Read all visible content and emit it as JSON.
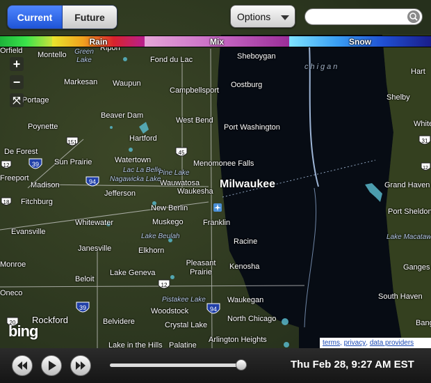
{
  "toolbar": {
    "current_label": "Current",
    "future_label": "Future",
    "options_label": "Options",
    "search_placeholder": ""
  },
  "legend": [
    {
      "label": "",
      "colors": [
        "#1db33a",
        "#3ae34a",
        "#c8e23c"
      ]
    },
    {
      "label": "Rain",
      "colors": [
        "#e9e52d",
        "#f0a21e",
        "#d8232d",
        "#b8208e"
      ]
    },
    {
      "label": "Mix",
      "colors": [
        "#e6a6d8",
        "#c86ac5",
        "#9b2e99"
      ]
    },
    {
      "label": "Snow",
      "colors": [
        "#7fe3ff",
        "#3aa0f3",
        "#1f4fd2",
        "#1a1d8a"
      ]
    }
  ],
  "map": {
    "water_name": "chigan",
    "main_city": "Milwaukee",
    "cities": [
      "Montello",
      "Ripon",
      "Fond du Lac",
      "Sheboygan",
      "Markesan",
      "Waupun",
      "Campbellsport",
      "Oostburg",
      "Portage",
      "Beaver Dam",
      "West Bend",
      "Port Washington",
      "Poynette",
      "Hartford",
      "De Forest",
      "Sun Prairie",
      "Watertown",
      "Menomonee Falls",
      "Madison",
      "Wauwatosa",
      "Waukesha",
      "Jefferson",
      "Fitchburg",
      "New Berlin",
      "Muskego",
      "Franklin",
      "Whitewater",
      "Evansville",
      "Janesville",
      "Elkhorn",
      "Racine",
      "Monroe",
      "Pleasant Prairie",
      "Kenosha",
      "Lake Geneva",
      "Beloit",
      "Waukegan",
      "Woodstock",
      "Rockford",
      "Belvidere",
      "Crystal Lake",
      "North Chicago",
      "Lake in the Hills",
      "Palatine",
      "Arlington Heights",
      "Hart",
      "Shelby",
      "Whitehall",
      "Grand Haven",
      "Port Sheldon",
      "Ganges",
      "South Haven",
      "Bangor",
      "Orfield",
      "Oneco",
      "Freeport"
    ],
    "lakes": [
      "Green Lake",
      "Lac La Belle",
      "Pine Lake",
      "Nagawicka Lake",
      "Lake Beulah",
      "Pistakee Lake",
      "Lake Macatawa"
    ],
    "highways": [
      "151",
      "45",
      "39",
      "94",
      "12",
      "18",
      "31",
      "12",
      "39",
      "94",
      "20",
      "12"
    ]
  },
  "bing_logo": "bing",
  "footer_links": {
    "terms": "terms",
    "privacy": "privacy",
    "data": "data providers"
  },
  "playback": {
    "timestamp": "Thu Feb 28, 9:27 AM EST",
    "progress": 1.0
  }
}
